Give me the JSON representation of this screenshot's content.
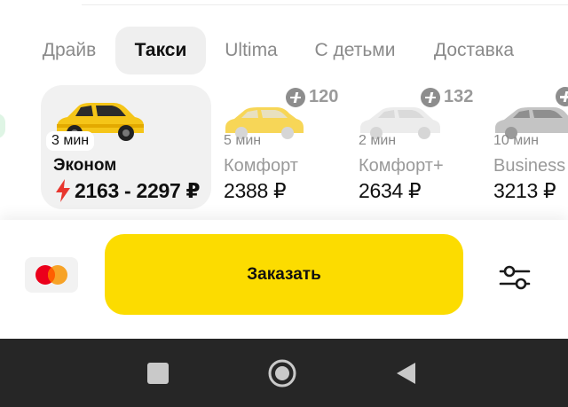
{
  "tabs": [
    {
      "label": "Драйв",
      "active": false
    },
    {
      "label": "Такси",
      "active": true
    },
    {
      "label": "Ultima",
      "active": false
    },
    {
      "label": "С детьми",
      "active": false
    },
    {
      "label": "Доставка",
      "active": false
    }
  ],
  "tariffs": [
    {
      "eta": "3 мин",
      "name": "Эконом",
      "price": "2163 - 2297 ₽",
      "selected": true,
      "surge_icon": "lightning-icon",
      "car_color": "#f5c518"
    },
    {
      "eta": "5 мин",
      "name": "Комфорт",
      "price": "2388 ₽",
      "bonus": "120",
      "car_color": "#f7d657"
    },
    {
      "eta": "2 мин",
      "name": "Комфорт+",
      "price": "2634 ₽",
      "bonus": "132",
      "car_color": "#e6e6e6"
    },
    {
      "eta": "10 мин",
      "name": "Business",
      "price": "3213 ₽",
      "bonus": "",
      "car_color": "#b9b9b9"
    }
  ],
  "bottom": {
    "order_label": "Заказать",
    "payment_icon": "mastercard-icon",
    "settings_icon": "filter-sliders-icon"
  },
  "system_nav": {
    "icons": [
      "recents-square-icon",
      "home-circle-icon",
      "back-triangle-icon"
    ]
  },
  "colors": {
    "accent": "#fcdc00",
    "surge": "#e8362e",
    "text": "#101010",
    "muted": "#8a8a8a"
  }
}
